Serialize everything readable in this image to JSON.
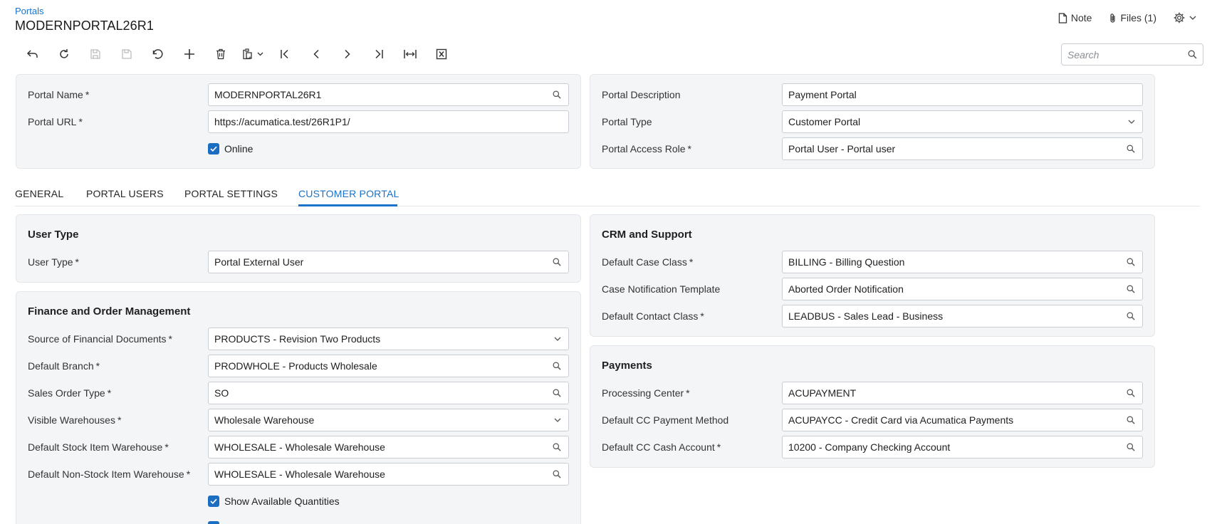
{
  "header": {
    "breadcrumb": "Portals",
    "title": "MODERNPORTAL26R1",
    "note_label": "Note",
    "files_label": "Files (1)"
  },
  "toolbar": {
    "buttons": [
      "back-icon",
      "refresh-icon",
      "save-close-icon",
      "save-icon",
      "undo-icon",
      "add-icon",
      "delete-icon",
      "paste-icon",
      "first-icon",
      "previous-icon",
      "next-icon",
      "last-icon",
      "fit-width-icon",
      "export-excel-icon"
    ]
  },
  "search": {
    "placeholder": "Search"
  },
  "summary": {
    "portal_name": {
      "label": "Portal Name",
      "value": "MODERNPORTAL26R1"
    },
    "portal_url": {
      "label": "Portal URL",
      "value": "https://acumatica.test/26R1P1/"
    },
    "online": {
      "label": "Online",
      "checked": true
    },
    "portal_description": {
      "label": "Portal Description",
      "value": "Payment Portal"
    },
    "portal_type": {
      "label": "Portal Type",
      "value": "Customer Portal"
    },
    "portal_access_role": {
      "label": "Portal Access Role",
      "value": "Portal User - Portal user"
    }
  },
  "tabs": {
    "general": "GENERAL",
    "portal_users": "PORTAL USERS",
    "portal_settings": "PORTAL SETTINGS",
    "customer_portal": "CUSTOMER PORTAL",
    "active": "customer_portal"
  },
  "user_type_section": {
    "title": "User Type",
    "user_type": {
      "label": "User Type",
      "value": "Portal External User"
    }
  },
  "finance_section": {
    "title": "Finance and Order Management",
    "source_fin_docs": {
      "label": "Source of Financial Documents",
      "value": "PRODUCTS - Revision Two Products"
    },
    "default_branch": {
      "label": "Default Branch",
      "value": "PRODWHOLE - Products Wholesale"
    },
    "sales_order_type": {
      "label": "Sales Order Type",
      "value": "SO"
    },
    "visible_warehouses": {
      "label": "Visible Warehouses",
      "value": "Wholesale Warehouse"
    },
    "default_stock_wh": {
      "label": "Default Stock Item Warehouse",
      "value": "WHOLESALE - Wholesale Warehouse"
    },
    "default_nonstock_wh": {
      "label": "Default Non-Stock Item Warehouse",
      "value": "WHOLESALE - Wholesale Warehouse"
    },
    "show_available_qty": {
      "label": "Show Available Quantities",
      "checked": true
    }
  },
  "crm_section": {
    "title": "CRM and Support",
    "default_case_class": {
      "label": "Default Case Class",
      "value": "BILLING - Billing Question"
    },
    "case_notification_template": {
      "label": "Case Notification Template",
      "value": "Aborted Order Notification"
    },
    "default_contact_class": {
      "label": "Default Contact Class",
      "value": "LEADBUS - Sales Lead - Business"
    }
  },
  "payments_section": {
    "title": "Payments",
    "processing_center": {
      "label": "Processing Center",
      "value": "ACUPAYMENT"
    },
    "default_cc_method": {
      "label": "Default CC Payment Method",
      "value": "ACUPAYCC - Credit Card via Acumatica Payments"
    },
    "default_cc_cash_account": {
      "label": "Default CC Cash Account",
      "value": "10200 - Company Checking Account"
    }
  },
  "colors": {
    "accent": "#1a73c8",
    "checkbox": "#1b6dc1",
    "panel_bg": "#f4f5f7"
  }
}
